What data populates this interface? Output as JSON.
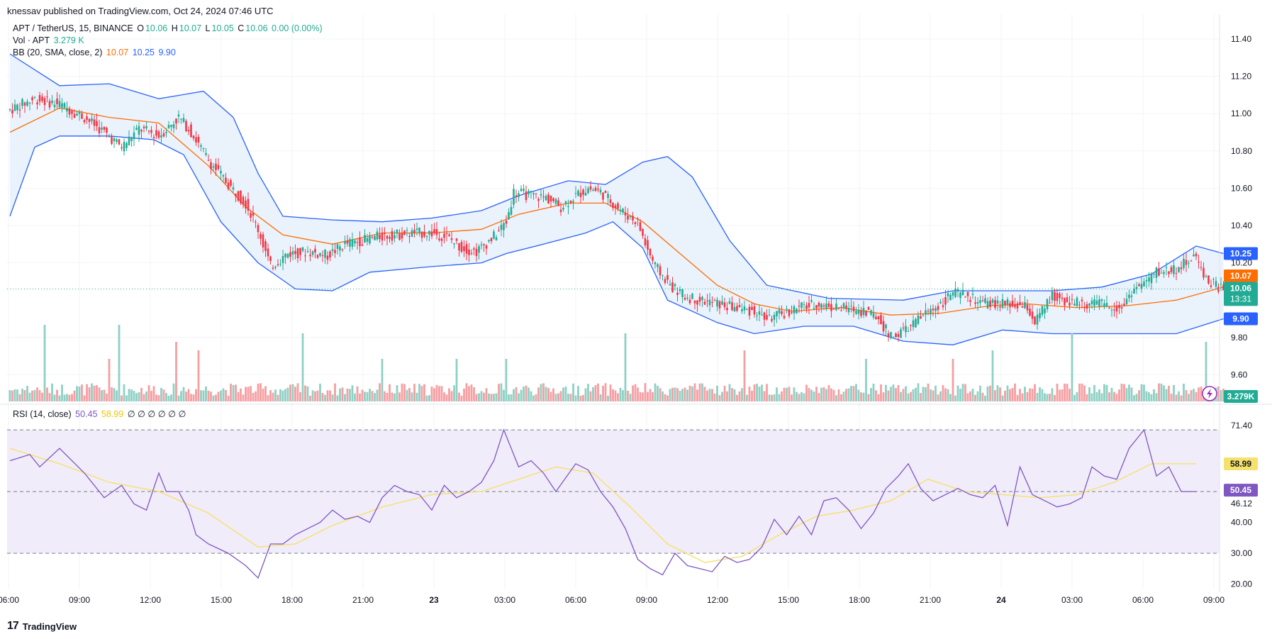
{
  "header": {
    "published": "knessav published on TradingView.com, Oct 24, 2024 07:46 UTC"
  },
  "legend": {
    "symbol": "APT / TetherUS, 15, BINANCE",
    "o_label": "O",
    "o": "10.06",
    "h_label": "H",
    "h": "10.07",
    "l_label": "L",
    "l": "10.05",
    "c_label": "C",
    "c": "10.06",
    "change": "0.00 (0.00%)",
    "vol_label": "Vol · APT",
    "vol_value": "3.279 K",
    "bb_label": "BB (20, SMA, close, 2)",
    "bb_basis": "10.07",
    "bb_upper": "10.25",
    "bb_lower": "9.90",
    "rsi_label": "RSI (14, close)",
    "rsi_value": "50.45",
    "rsi_ma": "58.99",
    "rsi_extra": "∅ ∅ ∅ ∅ ∅ ∅"
  },
  "footer": {
    "brand": "TradingView",
    "logo": "17"
  },
  "chart_data": [
    {
      "type": "candlestick",
      "symbol": "APT / TetherUS",
      "interval": "15",
      "price_axis": {
        "ticks": [
          "11.40",
          "11.20",
          "11.00",
          "10.80",
          "10.60",
          "10.40",
          "10.20",
          "9.80",
          "9.60"
        ],
        "ylim": [
          9.6,
          11.4
        ]
      },
      "time_axis": {
        "ticks": [
          "06:00",
          "09:00",
          "12:00",
          "15:00",
          "18:00",
          "21:00",
          "23",
          "03:00",
          "06:00",
          "09:00",
          "12:00",
          "15:00",
          "18:00",
          "21:00",
          "24",
          "03:00",
          "06:00",
          "09:00"
        ]
      },
      "labels": {
        "bb_upper": "10.25",
        "bb_basis": "10.07",
        "last_price": "10.06",
        "countdown": "13:31",
        "bb_lower": "9.90",
        "volume": "3.279K"
      },
      "price_path": [
        [
          0,
          11.02
        ],
        [
          10,
          11.08
        ],
        [
          20,
          11.05
        ],
        [
          30,
          10.98
        ],
        [
          38,
          10.9
        ],
        [
          45,
          10.82
        ],
        [
          52,
          10.92
        ],
        [
          60,
          10.88
        ],
        [
          68,
          10.98
        ],
        [
          72,
          10.92
        ],
        [
          80,
          10.75
        ],
        [
          88,
          10.62
        ],
        [
          95,
          10.52
        ],
        [
          100,
          10.38
        ],
        [
          105,
          10.18
        ],
        [
          112,
          10.25
        ],
        [
          120,
          10.26
        ],
        [
          128,
          10.24
        ],
        [
          135,
          10.3
        ],
        [
          142,
          10.32
        ],
        [
          148,
          10.34
        ],
        [
          155,
          10.35
        ],
        [
          163,
          10.36
        ],
        [
          170,
          10.36
        ],
        [
          176,
          10.34
        ],
        [
          182,
          10.28
        ],
        [
          188,
          10.26
        ],
        [
          195,
          10.34
        ],
        [
          200,
          10.42
        ],
        [
          203,
          10.58
        ],
        [
          210,
          10.56
        ],
        [
          216,
          10.55
        ],
        [
          222,
          10.5
        ],
        [
          228,
          10.56
        ],
        [
          233,
          10.6
        ],
        [
          238,
          10.58
        ],
        [
          243,
          10.52
        ],
        [
          248,
          10.46
        ],
        [
          253,
          10.42
        ],
        [
          256,
          10.3
        ],
        [
          260,
          10.18
        ],
        [
          266,
          10.08
        ],
        [
          272,
          10.02
        ],
        [
          278,
          10.0
        ],
        [
          285,
          9.98
        ],
        [
          292,
          9.96
        ],
        [
          300,
          9.94
        ],
        [
          305,
          9.9
        ],
        [
          310,
          9.92
        ],
        [
          318,
          9.96
        ],
        [
          326,
          9.98
        ],
        [
          333,
          9.96
        ],
        [
          340,
          9.95
        ],
        [
          346,
          9.94
        ],
        [
          350,
          9.9
        ],
        [
          355,
          9.8
        ],
        [
          358,
          9.82
        ],
        [
          363,
          9.86
        ],
        [
          368,
          9.92
        ],
        [
          375,
          9.98
        ],
        [
          380,
          10.04
        ],
        [
          386,
          10.02
        ],
        [
          392,
          9.98
        ],
        [
          398,
          9.98
        ],
        [
          405,
          9.97
        ],
        [
          410,
          9.96
        ],
        [
          413,
          9.88
        ],
        [
          416,
          9.94
        ],
        [
          420,
          10.02
        ],
        [
          425,
          10.0
        ],
        [
          432,
          9.98
        ],
        [
          438,
          9.98
        ],
        [
          443,
          9.97
        ],
        [
          448,
          9.96
        ],
        [
          452,
          10.05
        ],
        [
          458,
          10.1
        ],
        [
          462,
          10.15
        ],
        [
          467,
          10.16
        ],
        [
          472,
          10.18
        ],
        [
          477,
          10.24
        ],
        [
          483,
          10.1
        ],
        [
          489,
          10.06
        ]
      ],
      "bollinger": {
        "basis": [
          [
            0,
            10.9
          ],
          [
            20,
            11.03
          ],
          [
            40,
            10.98
          ],
          [
            60,
            10.95
          ],
          [
            80,
            10.72
          ],
          [
            95,
            10.5
          ],
          [
            110,
            10.35
          ],
          [
            130,
            10.3
          ],
          [
            150,
            10.36
          ],
          [
            170,
            10.36
          ],
          [
            190,
            10.38
          ],
          [
            205,
            10.46
          ],
          [
            225,
            10.52
          ],
          [
            240,
            10.52
          ],
          [
            255,
            10.42
          ],
          [
            270,
            10.25
          ],
          [
            285,
            10.08
          ],
          [
            300,
            9.98
          ],
          [
            315,
            9.94
          ],
          [
            335,
            9.96
          ],
          [
            355,
            9.92
          ],
          [
            375,
            9.93
          ],
          [
            395,
            9.97
          ],
          [
            410,
            9.98
          ],
          [
            430,
            9.96
          ],
          [
            450,
            9.97
          ],
          [
            470,
            10.0
          ],
          [
            489,
            10.07
          ]
        ],
        "upper": [
          [
            0,
            11.32
          ],
          [
            20,
            11.15
          ],
          [
            40,
            11.16
          ],
          [
            60,
            11.08
          ],
          [
            78,
            11.12
          ],
          [
            90,
            10.98
          ],
          [
            100,
            10.68
          ],
          [
            110,
            10.45
          ],
          [
            130,
            10.43
          ],
          [
            150,
            10.42
          ],
          [
            170,
            10.44
          ],
          [
            190,
            10.48
          ],
          [
            205,
            10.56
          ],
          [
            225,
            10.64
          ],
          [
            240,
            10.62
          ],
          [
            255,
            10.74
          ],
          [
            265,
            10.77
          ],
          [
            275,
            10.66
          ],
          [
            290,
            10.32
          ],
          [
            305,
            10.08
          ],
          [
            330,
            10.01
          ],
          [
            360,
            10.0
          ],
          [
            380,
            10.05
          ],
          [
            400,
            10.05
          ],
          [
            420,
            10.05
          ],
          [
            440,
            10.07
          ],
          [
            460,
            10.14
          ],
          [
            478,
            10.29
          ],
          [
            489,
            10.25
          ]
        ],
        "lower": [
          [
            0,
            10.45
          ],
          [
            10,
            10.82
          ],
          [
            20,
            10.88
          ],
          [
            40,
            10.88
          ],
          [
            58,
            10.86
          ],
          [
            70,
            10.78
          ],
          [
            85,
            10.42
          ],
          [
            100,
            10.2
          ],
          [
            115,
            10.06
          ],
          [
            130,
            10.05
          ],
          [
            145,
            10.15
          ],
          [
            170,
            10.18
          ],
          [
            190,
            10.2
          ],
          [
            200,
            10.25
          ],
          [
            215,
            10.3
          ],
          [
            232,
            10.36
          ],
          [
            243,
            10.42
          ],
          [
            255,
            10.28
          ],
          [
            265,
            10.0
          ],
          [
            285,
            9.88
          ],
          [
            300,
            9.82
          ],
          [
            320,
            9.86
          ],
          [
            340,
            9.86
          ],
          [
            360,
            9.78
          ],
          [
            380,
            9.76
          ],
          [
            400,
            9.84
          ],
          [
            420,
            9.82
          ],
          [
            440,
            9.82
          ],
          [
            455,
            9.82
          ],
          [
            470,
            9.82
          ],
          [
            489,
            9.9
          ]
        ]
      },
      "volume_spikes": [
        [
          14,
          "up"
        ],
        [
          40,
          "down"
        ],
        [
          44,
          "up"
        ],
        [
          67,
          "down"
        ],
        [
          76,
          "down"
        ],
        [
          118,
          "up"
        ],
        [
          150,
          "up"
        ],
        [
          180,
          "up"
        ],
        [
          200,
          "up"
        ],
        [
          248,
          "up"
        ],
        [
          296,
          "down"
        ],
        [
          345,
          "up"
        ],
        [
          380,
          "down"
        ],
        [
          396,
          "up"
        ],
        [
          428,
          "up"
        ],
        [
          482,
          "up"
        ]
      ]
    },
    {
      "type": "line",
      "name": "RSI (14, close)",
      "levels": {
        "upper": 70,
        "middle": 50,
        "lower": 30
      },
      "yaxis_ticks": [
        "71.40",
        "58.99",
        "50.45",
        "46.12",
        "40.00",
        "30.00",
        "20.00"
      ],
      "ylim": [
        17,
        75
      ],
      "rsi": [
        [
          0,
          60
        ],
        [
          8,
          62
        ],
        [
          12,
          58
        ],
        [
          20,
          64
        ],
        [
          25,
          60
        ],
        [
          30,
          56
        ],
        [
          38,
          48
        ],
        [
          45,
          52
        ],
        [
          50,
          46
        ],
        [
          55,
          44
        ],
        [
          60,
          56
        ],
        [
          63,
          50
        ],
        [
          68,
          50
        ],
        [
          72,
          44
        ],
        [
          75,
          36
        ],
        [
          80,
          33
        ],
        [
          88,
          30
        ],
        [
          95,
          26
        ],
        [
          100,
          22
        ],
        [
          105,
          33
        ],
        [
          110,
          33
        ],
        [
          115,
          36
        ],
        [
          120,
          38
        ],
        [
          125,
          40
        ],
        [
          130,
          44
        ],
        [
          135,
          41
        ],
        [
          140,
          42
        ],
        [
          145,
          40
        ],
        [
          150,
          48
        ],
        [
          155,
          52
        ],
        [
          160,
          50
        ],
        [
          165,
          49
        ],
        [
          170,
          44
        ],
        [
          175,
          52
        ],
        [
          180,
          48
        ],
        [
          185,
          50
        ],
        [
          190,
          53
        ],
        [
          195,
          60
        ],
        [
          199,
          70
        ],
        [
          205,
          58
        ],
        [
          210,
          60
        ],
        [
          215,
          56
        ],
        [
          220,
          50
        ],
        [
          228,
          59
        ],
        [
          233,
          57
        ],
        [
          238,
          50
        ],
        [
          243,
          45
        ],
        [
          248,
          38
        ],
        [
          253,
          28
        ],
        [
          258,
          25
        ],
        [
          263,
          23
        ],
        [
          268,
          30
        ],
        [
          273,
          26
        ],
        [
          278,
          25
        ],
        [
          283,
          24
        ],
        [
          288,
          29
        ],
        [
          293,
          27
        ],
        [
          298,
          28
        ],
        [
          303,
          32
        ],
        [
          308,
          41
        ],
        [
          313,
          36
        ],
        [
          318,
          42
        ],
        [
          323,
          36
        ],
        [
          328,
          47
        ],
        [
          333,
          48
        ],
        [
          338,
          44
        ],
        [
          343,
          38
        ],
        [
          348,
          43
        ],
        [
          353,
          51
        ],
        [
          358,
          55
        ],
        [
          362,
          59
        ],
        [
          367,
          51
        ],
        [
          372,
          47
        ],
        [
          377,
          49
        ],
        [
          382,
          51
        ],
        [
          387,
          49
        ],
        [
          392,
          48
        ],
        [
          397,
          52
        ],
        [
          402,
          39
        ],
        [
          407,
          58
        ],
        [
          412,
          49
        ],
        [
          417,
          47
        ],
        [
          422,
          45
        ],
        [
          427,
          46
        ],
        [
          432,
          48
        ],
        [
          436,
          58
        ],
        [
          441,
          55
        ],
        [
          446,
          54
        ],
        [
          451,
          64
        ],
        [
          457,
          70
        ],
        [
          462,
          55
        ],
        [
          467,
          58
        ],
        [
          472,
          50
        ],
        [
          478,
          50
        ]
      ],
      "rsi_ma": [
        [
          0,
          64
        ],
        [
          20,
          59
        ],
        [
          40,
          53
        ],
        [
          60,
          50
        ],
        [
          80,
          43
        ],
        [
          100,
          32
        ],
        [
          115,
          33
        ],
        [
          130,
          39
        ],
        [
          150,
          45
        ],
        [
          170,
          49
        ],
        [
          190,
          50
        ],
        [
          205,
          54
        ],
        [
          220,
          58
        ],
        [
          235,
          56
        ],
        [
          250,
          45
        ],
        [
          265,
          33
        ],
        [
          280,
          27
        ],
        [
          295,
          29
        ],
        [
          310,
          36
        ],
        [
          325,
          42
        ],
        [
          340,
          44
        ],
        [
          355,
          47
        ],
        [
          370,
          54
        ],
        [
          385,
          50
        ],
        [
          400,
          49
        ],
        [
          415,
          48
        ],
        [
          430,
          49
        ],
        [
          445,
          53
        ],
        [
          460,
          59
        ],
        [
          478,
          59
        ]
      ]
    }
  ],
  "colors": {
    "up": "#22ab94",
    "down": "#f23645",
    "vol_up": "#8fd0c4",
    "vol_down": "#f59fa2",
    "bb_band": "#2962ff",
    "bb_fill": "#eaf2fc",
    "bb_basis": "#ff6d00",
    "rsi": "#7e57c2",
    "rsi_ma": "#f5e16b",
    "rsi_bg": "#f1ecfa",
    "last_line": "#22ab94",
    "axis_text": "#131722",
    "grid": "#f0f3fa"
  }
}
